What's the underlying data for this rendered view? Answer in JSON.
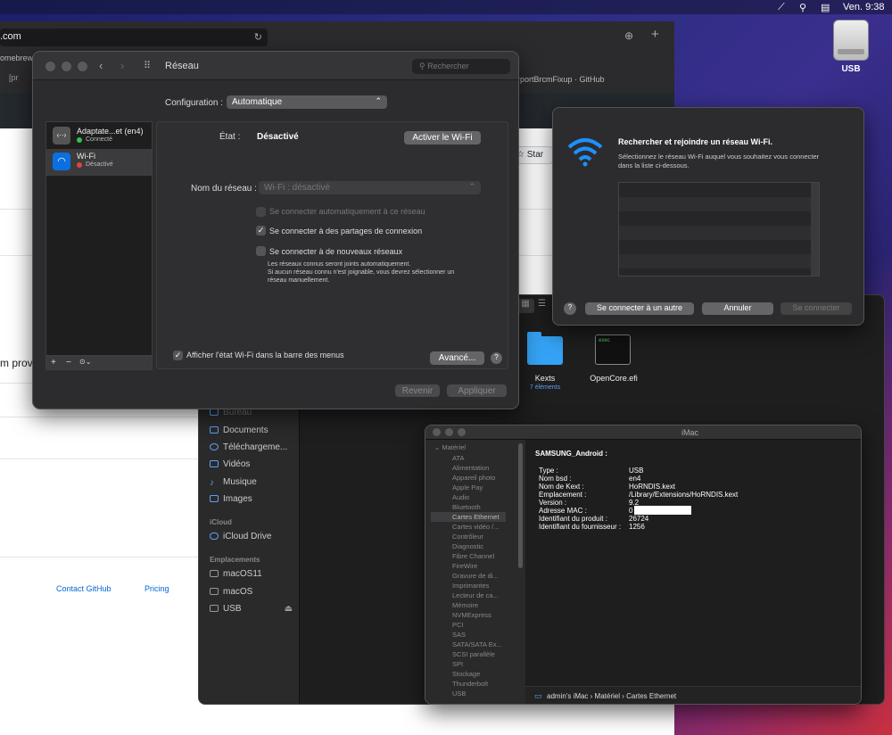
{
  "menubar": {
    "clock": "Ven. 9:38"
  },
  "desktop": {
    "usb_label": "USB"
  },
  "browser": {
    "url": ".com",
    "tab_left": "omebrew",
    "tab_left2": "[pr",
    "tab_right": "rportBrcmFixup · GitHub",
    "star": "Star",
    "prov": "m provi",
    "contact": "Contact GitHub",
    "pricing": "Pricing"
  },
  "finder": {
    "sidebar": {
      "bureau": "Bureau",
      "documents": "Documents",
      "downloads": "Téléchargeme...",
      "videos": "Vidéos",
      "music": "Musique",
      "images": "Images",
      "icloud_head": "iCloud",
      "icloud_drive": "iCloud Drive",
      "locations_head": "Emplacements",
      "loc1": "macOS11",
      "loc2": "macOS",
      "loc3": "USB"
    },
    "files": [
      {
        "name": "Kexts",
        "sub": "7 éléments"
      },
      {
        "name": "OpenCore.efi",
        "sub": ""
      }
    ],
    "exec_label": "exec"
  },
  "network": {
    "title": "Réseau",
    "search_placeholder": "Rechercher",
    "config_label": "Configuration :",
    "config_value": "Automatique",
    "services": [
      {
        "name": "Adaptate...et (en4)",
        "status": "Connecté",
        "color": "#30c24a"
      },
      {
        "name": "Wi-Fi",
        "status": "Désactivé",
        "color": "#e0443e"
      }
    ],
    "state_label": "État :",
    "state_value": "Désactivé",
    "activate_button": "Activer le Wi-Fi",
    "network_name_label": "Nom du réseau :",
    "network_name_value": "Wi-Fi : désactivé",
    "opt_auto": "Se connecter automatiquement à ce réseau",
    "opt_share": "Se connecter à des partages de connexion",
    "opt_new": "Se connecter à de nouveaux réseaux",
    "note1": "Les réseaux connus seront joints automatiquement.",
    "note2": "Si aucun réseau connu n'est joignable, vous devrez sélectionner un",
    "note3": "réseau manuellement.",
    "show_status": "Afficher l'état Wi-Fi dans la barre des menus",
    "advanced": "Avancé...",
    "help": "?",
    "revert": "Revenir",
    "apply": "Appliquer",
    "plus": "+",
    "minus": "−",
    "gear": "⊙⌄"
  },
  "wifi_dialog": {
    "title": "Rechercher et rejoindre un réseau Wi-Fi.",
    "desc1": "Sélectionnez le réseau Wi-Fi auquel vous souhaitez vous connecter",
    "desc2": "dans la liste ci-dessous.",
    "help": "?",
    "other": "Se connecter à un autre",
    "cancel": "Annuler",
    "connect": "Se connecter"
  },
  "sysinfo": {
    "title": "iMac",
    "section": "Matériel",
    "items": [
      "ATA",
      "Alimentation",
      "Appareil photo",
      "Apple Pay",
      "Audio",
      "Bluetooth",
      "Cartes Ethernet",
      "Cartes vidéo /...",
      "Contrôleur",
      "Diagnostic",
      "Fibre Channel",
      "FireWire",
      "Gravure de di...",
      "Imprimantes",
      "Lecteur de ca...",
      "Mémoire",
      "NVMExpress",
      "PCI",
      "SAS",
      "SATA/SATA Ex...",
      "SCSI parallèle",
      "SPI",
      "Stockage",
      "Thunderbolt",
      "USB"
    ],
    "device": "SAMSUNG_Android :",
    "keys": [
      "Type :",
      "Nom bsd :",
      "Nom de Kext :",
      "Emplacement :",
      "Version :",
      "Adresse MAC :",
      "Identifiant du produit :",
      "Identifiant du fournisseur :"
    ],
    "vals": [
      "USB",
      "en4",
      "HoRNDIS.kext",
      "/Library/Extensions/HoRNDIS.kext",
      "9.2",
      "0",
      "26724",
      "1256"
    ],
    "breadcrumb": "admin's iMac › Matériel › Cartes Ethernet"
  }
}
